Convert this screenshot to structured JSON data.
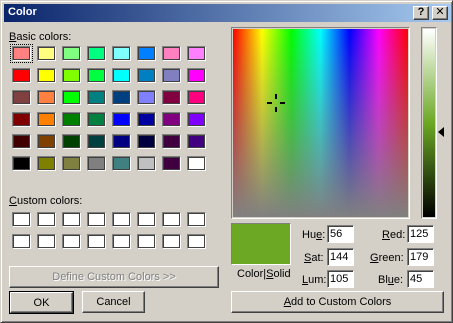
{
  "window": {
    "title": "Color",
    "help_icon": "help-icon",
    "close_icon": "close-icon"
  },
  "labels": {
    "basic_colors": "Basic colors:",
    "custom_colors": "Custom colors:",
    "color_solid": "Color|Solid"
  },
  "basic_colors": [
    "#ff8080",
    "#ffff80",
    "#80ff80",
    "#00ff80",
    "#80ffff",
    "#0080ff",
    "#ff80c0",
    "#ff80ff",
    "#ff0000",
    "#ffff00",
    "#80ff00",
    "#00ff40",
    "#00ffff",
    "#0080c0",
    "#8080c0",
    "#ff00ff",
    "#804040",
    "#ff8040",
    "#00ff00",
    "#008080",
    "#004080",
    "#8080ff",
    "#800040",
    "#ff0080",
    "#800000",
    "#ff8000",
    "#008000",
    "#008040",
    "#0000ff",
    "#0000a0",
    "#800080",
    "#8000ff",
    "#400000",
    "#804000",
    "#004000",
    "#004040",
    "#000080",
    "#000040",
    "#400040",
    "#400080",
    "#000000",
    "#808000",
    "#808040",
    "#808080",
    "#408080",
    "#c0c0c0",
    "#400040",
    "#ffffff"
  ],
  "selected_basic_index": 0,
  "custom_colors": [
    "#ffffff",
    "#ffffff",
    "#ffffff",
    "#ffffff",
    "#ffffff",
    "#ffffff",
    "#ffffff",
    "#ffffff",
    "#ffffff",
    "#ffffff",
    "#ffffff",
    "#ffffff",
    "#ffffff",
    "#ffffff",
    "#ffffff",
    "#ffffff"
  ],
  "buttons": {
    "define_custom": "Define Custom Colors >>",
    "ok": "OK",
    "cancel": "Cancel",
    "add_custom": "Add to Custom Colors"
  },
  "fields": {
    "hue_label": "Hue:",
    "sat_label": "Sat:",
    "lum_label": "Lum:",
    "red_label": "Red:",
    "green_label": "Green:",
    "blue_label": "Blue:",
    "hue": "56",
    "sat": "144",
    "lum": "105",
    "red": "125",
    "green": "179",
    "blue": "45"
  },
  "preview_color": "#6ca824",
  "crosshair_icon": "crosshair-icon",
  "lum_arrow_icon": "arrow-left-icon"
}
